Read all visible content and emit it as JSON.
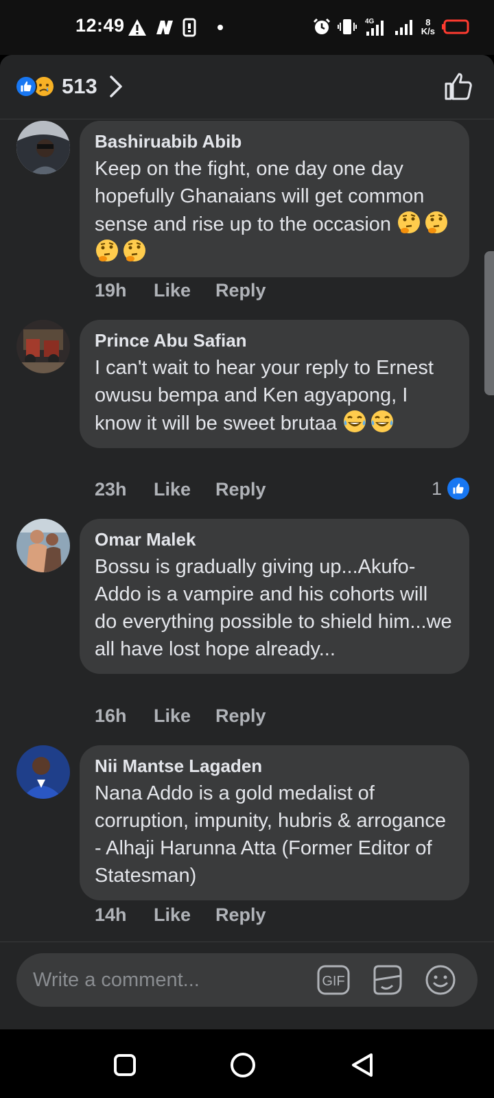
{
  "status_bar": {
    "time": "12:49",
    "network_type": "4G",
    "speed_value": "8",
    "speed_unit": "K/s"
  },
  "header": {
    "reaction_count": "513",
    "reaction_icons": [
      "like-icon",
      "sad-face-icon"
    ]
  },
  "comments": [
    {
      "author": "Bashiruabib Abib",
      "text": "Keep on the fight, one day one day hopefully Ghanaians will get common sense and rise up to the occasion",
      "emojis": [
        "🤔",
        "🤔",
        "🤔",
        "🤔"
      ],
      "time": "19h",
      "like_label": "Like",
      "reply_label": "Reply"
    },
    {
      "author": "Prince Abu Safian",
      "text": "I can't wait to hear your reply to Ernest owusu bempa and Ken agyapong, I know it will be sweet brutaa",
      "emojis": [
        "😂",
        "😂"
      ],
      "time": "23h",
      "like_label": "Like",
      "reply_label": "Reply",
      "reaction_count": "1"
    },
    {
      "author": "Omar Malek",
      "text": "Bossu is gradually giving up...Akufo-Addo is a vampire and his cohorts will do everything possible to shield him...we all have lost hope already...",
      "time": "16h",
      "like_label": "Like",
      "reply_label": "Reply"
    },
    {
      "author": "Nii Mantse Lagaden",
      "text": "Nana Addo is a gold medalist of corruption, impunity, hubris & arrogance - Alhaji Harunna Atta (Former Editor of Statesman)",
      "time": "14h",
      "like_label": "Like",
      "reply_label": "Reply"
    }
  ],
  "composer": {
    "placeholder": "Write a comment...",
    "gif_label": "GIF"
  },
  "colors": {
    "background": "#242526",
    "bubble": "#3a3b3c",
    "accent": "#1877f2",
    "muted_text": "#b0b3b8"
  }
}
